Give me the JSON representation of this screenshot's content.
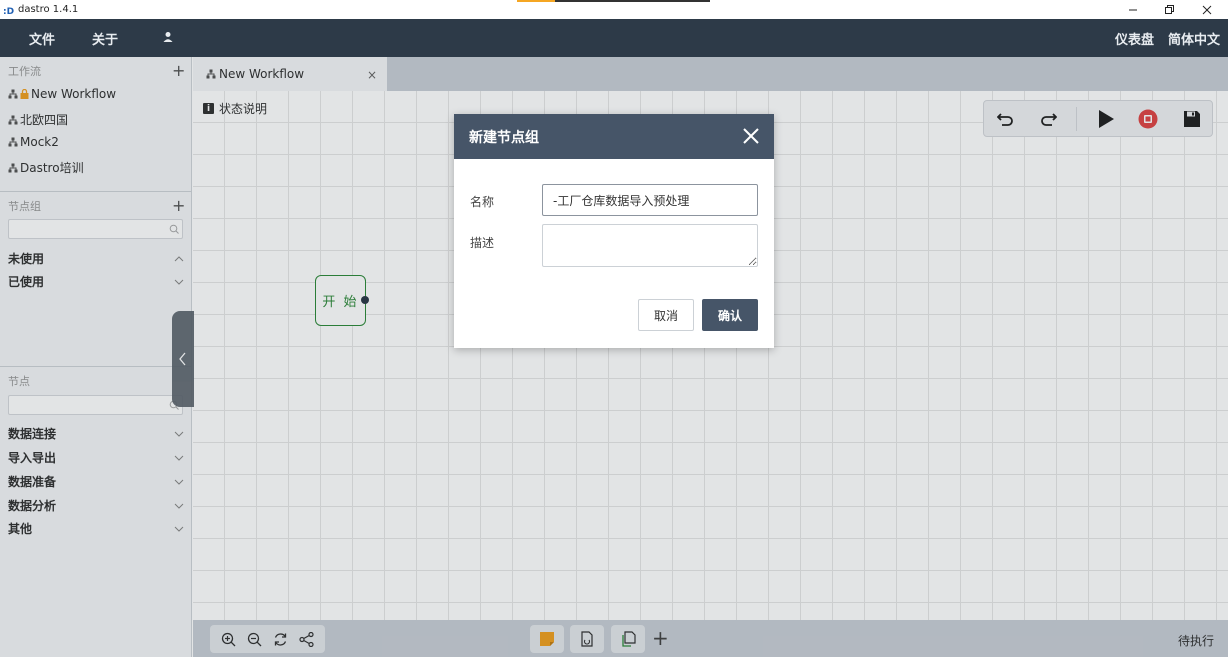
{
  "window": {
    "title": "dastro 1.4.1",
    "controls": [
      "minimize-icon",
      "maximize-icon",
      "close-icon"
    ]
  },
  "menubar": {
    "file": "文件",
    "about": "关于",
    "user_icon": "user-icon",
    "dashboard": "仪表盘",
    "language": "简体中文"
  },
  "sidebar": {
    "workflows": {
      "header": "工作流",
      "items": [
        {
          "label": "New Workflow",
          "locked": true
        },
        {
          "label": "北欧四国"
        },
        {
          "label": "Mock2"
        },
        {
          "label": "Dastro培训"
        }
      ]
    },
    "node_groups": {
      "header": "节点组",
      "search_value": "",
      "categories": [
        {
          "label": "未使用",
          "expanded": true
        },
        {
          "label": "已使用",
          "expanded": false
        }
      ]
    },
    "nodes": {
      "header": "节点",
      "search_value": "",
      "categories": [
        {
          "label": "数据连接"
        },
        {
          "label": "导入导出"
        },
        {
          "label": "数据准备"
        },
        {
          "label": "数据分析"
        },
        {
          "label": "其他"
        }
      ]
    }
  },
  "tabs": [
    {
      "label": "New Workflow",
      "close": "×"
    }
  ],
  "canvas": {
    "status_legend": "状态说明",
    "start_node": "开 始",
    "toolbar": [
      "undo-icon",
      "redo-icon",
      "run-icon",
      "stop-icon",
      "save-icon"
    ]
  },
  "bottombar": {
    "zoom_tools": [
      "zoom-in-icon",
      "zoom-out-icon",
      "refresh-icon",
      "share-icon"
    ],
    "tools": [
      "note-icon",
      "file-icon",
      "copy-icon",
      "add-icon"
    ],
    "status": "待执行"
  },
  "dialog": {
    "title": "新建节点组",
    "name_label": "名称",
    "name_value": "-工厂仓库数据导入预处理",
    "desc_label": "描述",
    "desc_value": "",
    "cancel": "取消",
    "confirm": "确认"
  },
  "colors": {
    "menubar_bg": "#2d3a48",
    "dialog_header": "#465568",
    "start_node": "#2f8a3b",
    "stop_red": "#e04646"
  }
}
